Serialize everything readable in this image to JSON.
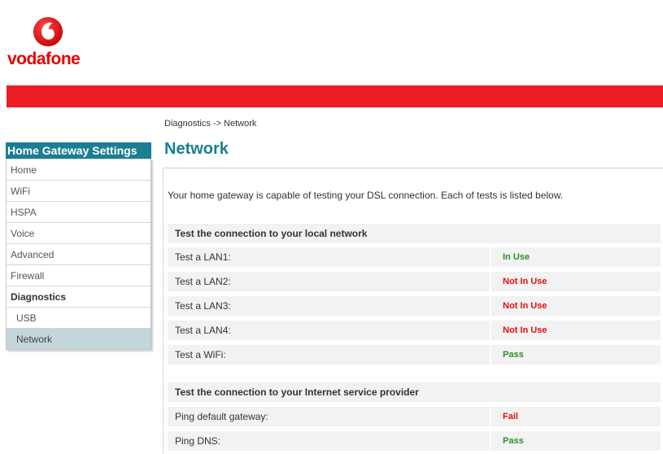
{
  "brand": {
    "name": "vodafone",
    "color": "#e60000",
    "logo_icon": "vodafone-speech-mark-icon"
  },
  "breadcrumb": "Diagnostics -> Network",
  "sidebar": {
    "title": "Home Gateway Settings",
    "items": [
      {
        "label": "Home"
      },
      {
        "label": "WiFi"
      },
      {
        "label": "HSPA"
      },
      {
        "label": "Voice"
      },
      {
        "label": "Advanced"
      },
      {
        "label": "Firewall"
      },
      {
        "label": "Diagnostics"
      },
      {
        "label": "USB"
      },
      {
        "label": "Network"
      }
    ]
  },
  "page": {
    "title": "Network",
    "intro": "Your home gateway is capable of testing your DSL connection. Each of tests is listed below."
  },
  "local_tests": {
    "heading": "Test the connection to your local network",
    "rows": [
      {
        "label": "Test a LAN1:",
        "result": "In Use"
      },
      {
        "label": "Test a LAN2:",
        "result": "Not In Use"
      },
      {
        "label": "Test a LAN3:",
        "result": "Not In Use"
      },
      {
        "label": "Test a LAN4:",
        "result": "Not In Use"
      },
      {
        "label": "Test a WiFi:",
        "result": "Pass"
      }
    ]
  },
  "isp_tests": {
    "heading": "Test the connection to your Internet service provider",
    "rows": [
      {
        "label": "Ping default gateway:",
        "result": "Fail"
      },
      {
        "label": "Ping DNS:",
        "result": "Pass"
      }
    ]
  },
  "colors": {
    "accent": "#1a7f93",
    "red_bar": "#ee1c25",
    "pass": "#2e8b2e",
    "fail": "#e01010",
    "active_nav": "#c2d6dc"
  }
}
